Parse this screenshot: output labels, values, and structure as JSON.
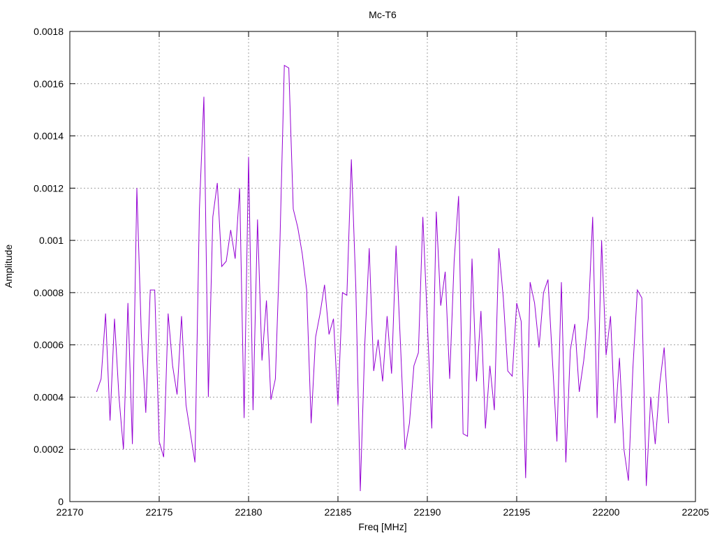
{
  "chart_data": {
    "type": "line",
    "title": "Mc-T6",
    "xlabel": "Freq [MHz]",
    "ylabel": "Amplitude",
    "xlim": [
      22170,
      22205
    ],
    "ylim": [
      0,
      0.0018
    ],
    "x_ticks": [
      "22170",
      "22175",
      "22180",
      "22185",
      "22190",
      "22195",
      "22200",
      "22205"
    ],
    "y_ticks": [
      "0",
      "0.0002",
      "0.0004",
      "0.0006",
      "0.0008",
      "0.001",
      "0.0012",
      "0.0014",
      "0.0016",
      "0.0018"
    ],
    "grid": true,
    "line_color": "#9400d3",
    "series": [
      {
        "x": [
          22171.5,
          22171.75,
          22172.0,
          22172.25,
          22172.5,
          22172.75,
          22173.0,
          22173.25,
          22173.5,
          22173.75,
          22174.0,
          22174.25,
          22174.5,
          22174.75,
          22175.0,
          22175.25,
          22175.5,
          22175.75,
          22176.0,
          22176.25,
          22176.5,
          22176.75,
          22177.0,
          22177.25,
          22177.5,
          22177.75,
          22178.0,
          22178.25,
          22178.5,
          22178.75,
          22179.0,
          22179.25,
          22179.5,
          22179.75,
          22180.0,
          22180.25,
          22180.5,
          22180.75,
          22181.0,
          22181.25,
          22181.5,
          22181.75,
          22182.0,
          22182.25,
          22182.5,
          22182.75,
          22183.0,
          22183.25,
          22183.5,
          22183.75,
          22184.0,
          22184.25,
          22184.5,
          22184.75,
          22185.0,
          22185.25,
          22185.5,
          22185.75,
          22186.0,
          22186.25,
          22186.5,
          22186.75,
          22187.0,
          22187.25,
          22187.5,
          22187.75,
          22188.0,
          22188.25,
          22188.5,
          22188.75,
          22189.0,
          22189.25,
          22189.5,
          22189.75,
          22190.0,
          22190.25,
          22190.5,
          22190.75,
          22191.0,
          22191.25,
          22191.5,
          22191.75,
          22192.0,
          22192.25,
          22192.5,
          22192.75,
          22193.0,
          22193.25,
          22193.5,
          22193.75,
          22194.0,
          22194.25,
          22194.5,
          22194.75,
          22195.0,
          22195.25,
          22195.5,
          22195.75,
          22196.0,
          22196.25,
          22196.5,
          22196.75,
          22197.0,
          22197.25,
          22197.5,
          22197.75,
          22198.0,
          22198.25,
          22198.5,
          22198.75,
          22199.0,
          22199.25,
          22199.5,
          22199.75,
          22200.0,
          22200.25,
          22200.5,
          22200.75,
          22201.0,
          22201.25,
          22201.5,
          22201.75,
          22202.0,
          22202.25,
          22202.5,
          22202.75,
          22203.0,
          22203.25,
          22203.5
        ],
        "y": [
          0.00042,
          0.00047,
          0.00072,
          0.00031,
          0.0007,
          0.0004,
          0.0002,
          0.00076,
          0.00022,
          0.0012,
          0.00064,
          0.00034,
          0.00081,
          0.00081,
          0.00023,
          0.00017,
          0.00072,
          0.00052,
          0.00041,
          0.00071,
          0.00037,
          0.00026,
          0.00015,
          0.00112,
          0.00155,
          0.0004,
          0.00109,
          0.00122,
          0.0009,
          0.00092,
          0.00104,
          0.00093,
          0.0012,
          0.00032,
          0.00132,
          0.00035,
          0.00108,
          0.00054,
          0.00077,
          0.00039,
          0.00047,
          0.00098,
          0.00167,
          0.00166,
          0.00112,
          0.00105,
          0.00095,
          0.00081,
          0.0003,
          0.00063,
          0.00072,
          0.00083,
          0.00064,
          0.0007,
          0.00037,
          0.0008,
          0.00079,
          0.00131,
          0.00082,
          4e-05,
          0.0006,
          0.00097,
          0.0005,
          0.00062,
          0.00046,
          0.00071,
          0.00049,
          0.00098,
          0.0006,
          0.0002,
          0.0003,
          0.00052,
          0.00057,
          0.00109,
          0.00069,
          0.00028,
          0.00111,
          0.00075,
          0.00088,
          0.00047,
          0.00092,
          0.00117,
          0.00026,
          0.00025,
          0.00093,
          0.00046,
          0.00073,
          0.00028,
          0.00052,
          0.00035,
          0.00097,
          0.00078,
          0.0005,
          0.00048,
          0.00076,
          0.00069,
          9e-05,
          0.00084,
          0.00076,
          0.00059,
          0.0008,
          0.00085,
          0.00054,
          0.00023,
          0.00084,
          0.00015,
          0.00058,
          0.00068,
          0.00042,
          0.00054,
          0.0007,
          0.00109,
          0.00032,
          0.001,
          0.00056,
          0.00071,
          0.0003,
          0.00055,
          0.0002,
          8e-05,
          0.00051,
          0.00081,
          0.00078,
          6e-05,
          0.0004,
          0.00022,
          0.00045,
          0.00059,
          0.0003
        ]
      }
    ]
  }
}
